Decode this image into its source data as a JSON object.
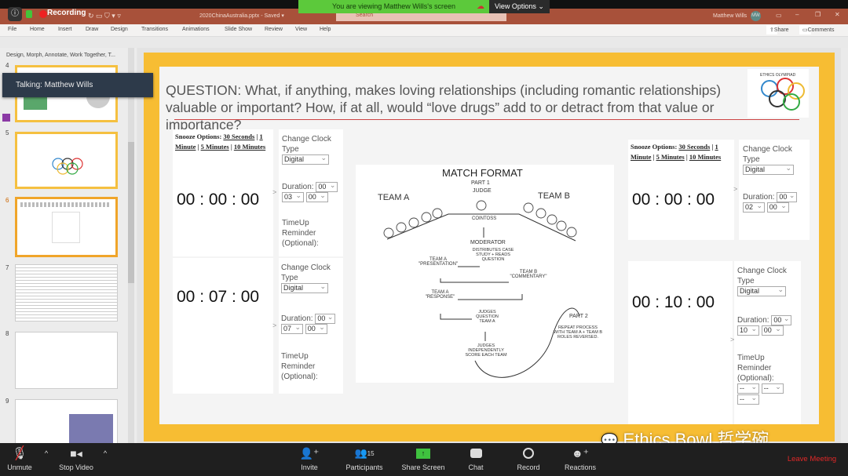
{
  "zoom_banner": {
    "viewing": "You are viewing Matthew Wills's screen",
    "view_options": "View Options",
    "recording": "Recording"
  },
  "powerpoint": {
    "file_title": "2020ChinaAustralia.pptx",
    "saved": "Saved",
    "search_placeholder": "Search",
    "user": "Matthew Wills",
    "initials": "MW",
    "ribbon_tabs": [
      "File",
      "Home",
      "Insert",
      "Draw",
      "Design",
      "Transitions",
      "Animations",
      "Slide Show",
      "Review",
      "View",
      "Help"
    ],
    "share": "Share",
    "comments": "Comments",
    "section": "Design, Morph, Annotate, Work Together, T...",
    "slide_numbers": [
      "4",
      "5",
      "6",
      "7",
      "8",
      "9"
    ],
    "selected_slide": "6"
  },
  "talking": "Talking: Matthew Wills",
  "slide": {
    "question": "QUESTION: What, if anything, makes loving relationships (including romantic relationships) valuable or important? How, if at all, would “love drugs” add to or detract from that value or importance?",
    "logo_text": "ETHICS OLYMPIAD",
    "timers": [
      {
        "snooze_label": "Snooze Options:",
        "snooze": [
          "30 Seconds",
          "1 Minute",
          "5 Minutes",
          "10 Minutes"
        ],
        "clock": "00 : 00 : 00",
        "clock_type_label": "Change Clock Type",
        "clock_type": "Digital",
        "duration_label": "Duration:",
        "hours": "00",
        "minutes": "03",
        "seconds": "00",
        "reminder_label": "TimeUp Reminder (Optional):"
      },
      {
        "clock": "00 : 07 : 00",
        "clock_type_label": "Change Clock Type",
        "clock_type": "Digital",
        "duration_label": "Duration:",
        "hours": "00",
        "minutes": "07",
        "seconds": "00",
        "reminder_label": "TimeUp Reminder (Optional):"
      },
      {
        "snooze_label": "Snooze Options:",
        "snooze": [
          "30 Seconds",
          "1 Minute",
          "5 Minutes",
          "10 Minutes"
        ],
        "clock": "00 : 00 : 00",
        "clock_type_label": "Change Clock Type",
        "clock_type": "Digital",
        "duration_label": "Duration:",
        "hours": "00",
        "minutes": "02",
        "seconds": "00"
      },
      {
        "clock": "00 : 10 : 00",
        "clock_type_label": "Change Clock Type",
        "clock_type": "Digital",
        "duration_label": "Duration:",
        "hours": "00",
        "minutes": "10",
        "seconds": "00",
        "reminder_label": "TimeUp Reminder (Optional):",
        "reminder": [
          "--",
          "--",
          "--"
        ]
      }
    ],
    "diagram": {
      "title": "MATCH FORMAT",
      "part1": "PART 1",
      "judge": "JUDGE",
      "team_a": "TEAM A",
      "team_b": "TEAM B",
      "coin_toss": "COINTOSS",
      "moderator": "MODERATOR",
      "distributes": "DISTRIBUTES CASE STUDY + READS QUESTION",
      "presentation": "TEAM A \"PRESENTATION\"",
      "commentary": "TEAM B \"COMMENTARY\"",
      "response": "TEAM A \"RESPONSE\"",
      "judges_q": "JUDGES QUESTION TEAM A",
      "judges_s": "JUDGES INDEPENDENTLY SCORE EACH TEAM",
      "part2": "PART 2",
      "repeat": "REPEAT PROCESS WITH TEAM A + TEAM B ROLES REVERSED."
    }
  },
  "toolbar": {
    "unmute": "Unmute",
    "stop_video": "Stop Video",
    "invite": "Invite",
    "participants": "Participants",
    "participant_count": "15",
    "share_screen": "Share Screen",
    "chat": "Chat",
    "record": "Record",
    "reactions": "Reactions",
    "leave": "Leave Meeting",
    "leave_color": "#e02828",
    "share_color": "#3fc23f"
  },
  "watermark": "Ethics Bowl 哲学碗"
}
